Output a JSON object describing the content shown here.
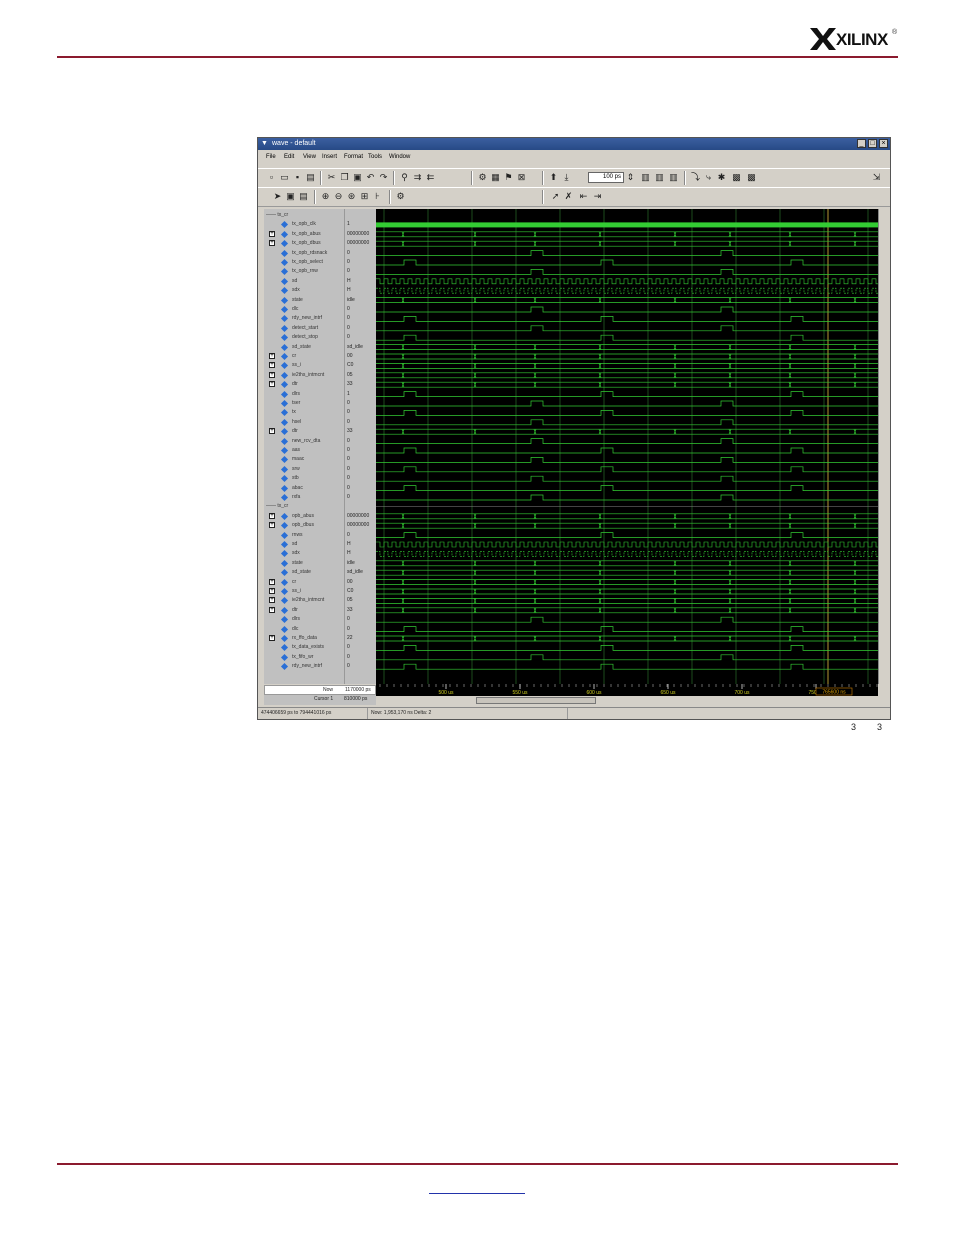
{
  "header": {
    "brand": "XILINX",
    "registered": "®"
  },
  "window": {
    "title": "wave - default",
    "menu": [
      "File",
      "Edit",
      "View",
      "Insert",
      "Format",
      "Tools",
      "Window"
    ],
    "zoom": "100 ps",
    "buttons": {
      "minimize": "_",
      "maximize": "□",
      "close": "×"
    }
  },
  "groups": {
    "top": "tx_cr",
    "bottom": "tx_cr"
  },
  "signals_top": [
    {
      "name": "tx_opb_clk",
      "value": "1",
      "expand": false
    },
    {
      "name": "tx_opb_abus",
      "value": "00000000",
      "expand": true
    },
    {
      "name": "tx_opb_dbus",
      "value": "00000000",
      "expand": true
    },
    {
      "name": "tx_opb_rdsnack",
      "value": "0",
      "expand": false
    },
    {
      "name": "tx_opb_select",
      "value": "0",
      "expand": false
    },
    {
      "name": "tx_opb_rnw",
      "value": "0",
      "expand": false
    },
    {
      "name": "sd",
      "value": "H",
      "expand": false
    },
    {
      "name": "sdx",
      "value": "H",
      "expand": false
    },
    {
      "name": "state",
      "value": "idle",
      "expand": false
    },
    {
      "name": "dlc",
      "value": "0",
      "expand": false
    },
    {
      "name": "rdy_new_intrf",
      "value": "0",
      "expand": false
    },
    {
      "name": "detect_start",
      "value": "0",
      "expand": false
    },
    {
      "name": "detect_stop",
      "value": "0",
      "expand": false
    },
    {
      "name": "sd_state",
      "value": "sd_idle",
      "expand": false
    },
    {
      "name": "cr",
      "value": "00",
      "expand": true
    },
    {
      "name": "ss_i",
      "value": "C0",
      "expand": true
    },
    {
      "name": "ie2ths_intmcnt",
      "value": "05",
      "expand": true
    },
    {
      "name": "dtr",
      "value": "33",
      "expand": true
    },
    {
      "name": "dlrs",
      "value": "1",
      "expand": false
    },
    {
      "name": "tser",
      "value": "0",
      "expand": false
    },
    {
      "name": "tx",
      "value": "0",
      "expand": false
    },
    {
      "name": "hsel",
      "value": "0",
      "expand": false
    },
    {
      "name": "dtr",
      "value": "33",
      "expand": true
    },
    {
      "name": "new_rcv_dta",
      "value": "0",
      "expand": false
    },
    {
      "name": "aas",
      "value": "0",
      "expand": false
    },
    {
      "name": "maac",
      "value": "0",
      "expand": false
    },
    {
      "name": "srw",
      "value": "0",
      "expand": false
    },
    {
      "name": "stb",
      "value": "0",
      "expand": false
    },
    {
      "name": "abac",
      "value": "0",
      "expand": false
    },
    {
      "name": "rxfa",
      "value": "0",
      "expand": false
    }
  ],
  "signals_bottom": [
    {
      "name": "opb_abus",
      "value": "00000000",
      "expand": true
    },
    {
      "name": "opb_dbus",
      "value": "00000000",
      "expand": true
    },
    {
      "name": "rnws",
      "value": "0",
      "expand": false
    },
    {
      "name": "sd",
      "value": "H",
      "expand": false
    },
    {
      "name": "sdx",
      "value": "H",
      "expand": false
    },
    {
      "name": "state",
      "value": "idle",
      "expand": false
    },
    {
      "name": "sd_state",
      "value": "sd_idle",
      "expand": false
    },
    {
      "name": "cr",
      "value": "00",
      "expand": true
    },
    {
      "name": "ss_i",
      "value": "C0",
      "expand": true
    },
    {
      "name": "ie2ths_intmcnt",
      "value": "05",
      "expand": true
    },
    {
      "name": "dtr",
      "value": "33",
      "expand": true
    },
    {
      "name": "dlrs",
      "value": "0",
      "expand": false
    },
    {
      "name": "dlc",
      "value": "0",
      "expand": false
    },
    {
      "name": "rx_ffo_data",
      "value": "22",
      "expand": true
    },
    {
      "name": "tx_data_exists",
      "value": "0",
      "expand": false
    },
    {
      "name": "tx_fifo_wr",
      "value": "0",
      "expand": false
    },
    {
      "name": "rdy_new_intrf",
      "value": "0",
      "expand": false
    }
  ],
  "timeline": {
    "now_label": "Now",
    "now_value": "1170000 ps",
    "cursor_label": "Cursor 1",
    "cursor_value": "810000 ps",
    "ticks": [
      "500 us",
      "550 us",
      "600 us",
      "650 us",
      "700 us",
      "750 us"
    ],
    "cursor_readout": "765600 ns"
  },
  "status": {
    "range": "474406659 ps to 794441016 ps",
    "info": "Now: 1,953,170 ns  Delta: 2"
  },
  "page_numbers": [
    "3",
    "3"
  ],
  "colors": {
    "wave": "#33cc33",
    "grid": "#2e7d2e",
    "brand_rule": "#8b1a2e"
  }
}
